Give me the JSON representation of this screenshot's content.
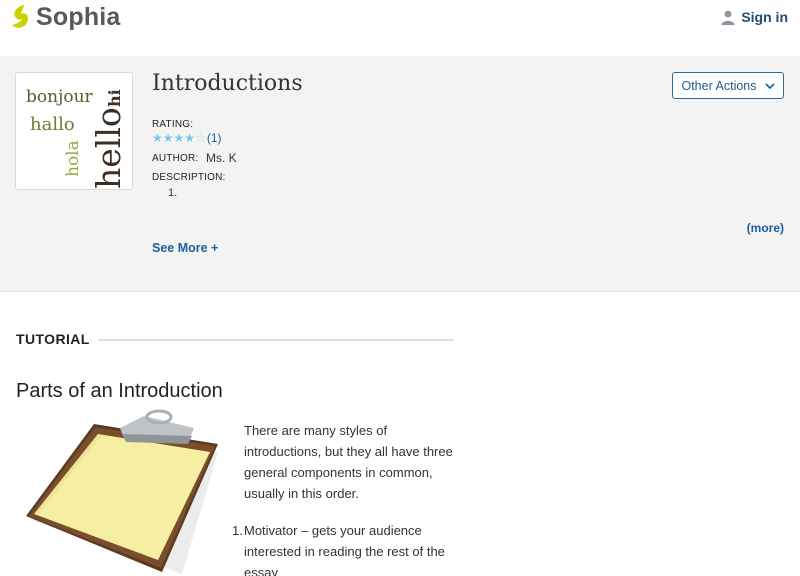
{
  "brand": {
    "name": "Sophia",
    "accent": "#c8d300"
  },
  "header": {
    "signin_label": "Sign in",
    "user_icon": "user-icon"
  },
  "lesson": {
    "title": "Introductions",
    "thumbnail_words": [
      "hi",
      "bonjour",
      "hallo",
      "hola",
      "hello"
    ],
    "rating_label": "RATING:",
    "rating_value": 4,
    "rating_max": 5,
    "rating_count": "(1)",
    "author_label": "AUTHOR:",
    "author_value": "Ms. K",
    "description_label": "DESCRIPTION:",
    "description_item": "1.",
    "more_label": "(more)",
    "see_more_label": "See More +",
    "actions_label": "Other Actions"
  },
  "content": {
    "section_label": "TUTORIAL",
    "heading": "Parts of an Introduction",
    "image_icon": "clipboard-image",
    "paragraph": "There are many styles of introductions, but they all have three general components in common, usually in this order.",
    "list": [
      {
        "num": "1.",
        "text": "Motivator – gets your audience interested in reading the rest of the essay"
      }
    ]
  },
  "colors": {
    "link": "#1b5fa0",
    "star": "#7dc5e5",
    "panel": "#f3f3f3"
  }
}
